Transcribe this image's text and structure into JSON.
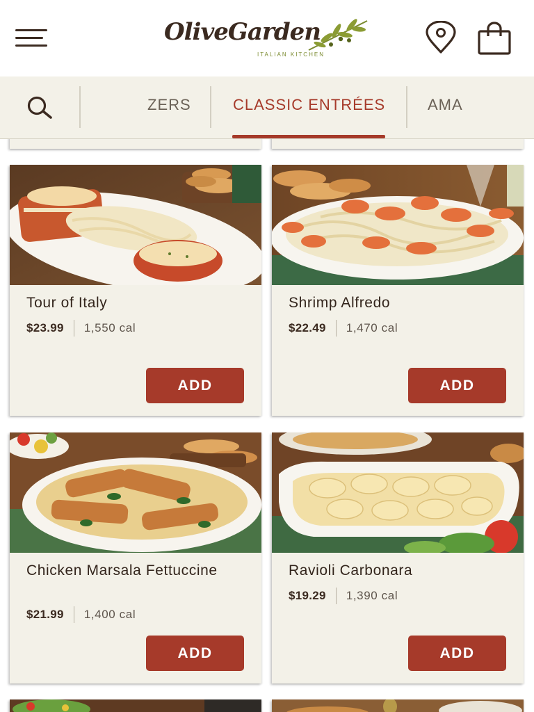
{
  "header": {
    "brand_name": "OliveGarden",
    "brand_tagline": "ITALIAN KITCHEN"
  },
  "categories": {
    "tabs": [
      {
        "label": "ZERS",
        "active": false
      },
      {
        "label": "CLASSIC ENTRÉES",
        "active": true
      },
      {
        "label": "AMA",
        "active": false
      }
    ]
  },
  "colors": {
    "accent": "#a63a2a",
    "bar_background": "#f3f1e8",
    "text_dark": "#3b2a20",
    "olive": "#7a8a2e"
  },
  "menu": {
    "items": [
      {
        "name": "Tour of Italy",
        "price": "$23.99",
        "calories": "1,550 cal",
        "add_label": "ADD",
        "image": "tour-of-italy-plate"
      },
      {
        "name": "Shrimp Alfredo",
        "price": "$22.49",
        "calories": "1,470 cal",
        "add_label": "ADD",
        "image": "shrimp-alfredo-plate"
      },
      {
        "name": "Chicken Marsala Fettuccine",
        "price": "$21.99",
        "calories": "1,400 cal",
        "add_label": "ADD",
        "image": "chicken-marsala-plate"
      },
      {
        "name": "Ravioli Carbonara",
        "price": "$19.29",
        "calories": "1,390 cal",
        "add_label": "ADD",
        "image": "ravioli-carbonara-plate"
      }
    ]
  },
  "icons": {
    "menu": "hamburger-menu-icon",
    "location": "location-pin-icon",
    "bag": "shopping-bag-icon",
    "search": "search-icon"
  }
}
